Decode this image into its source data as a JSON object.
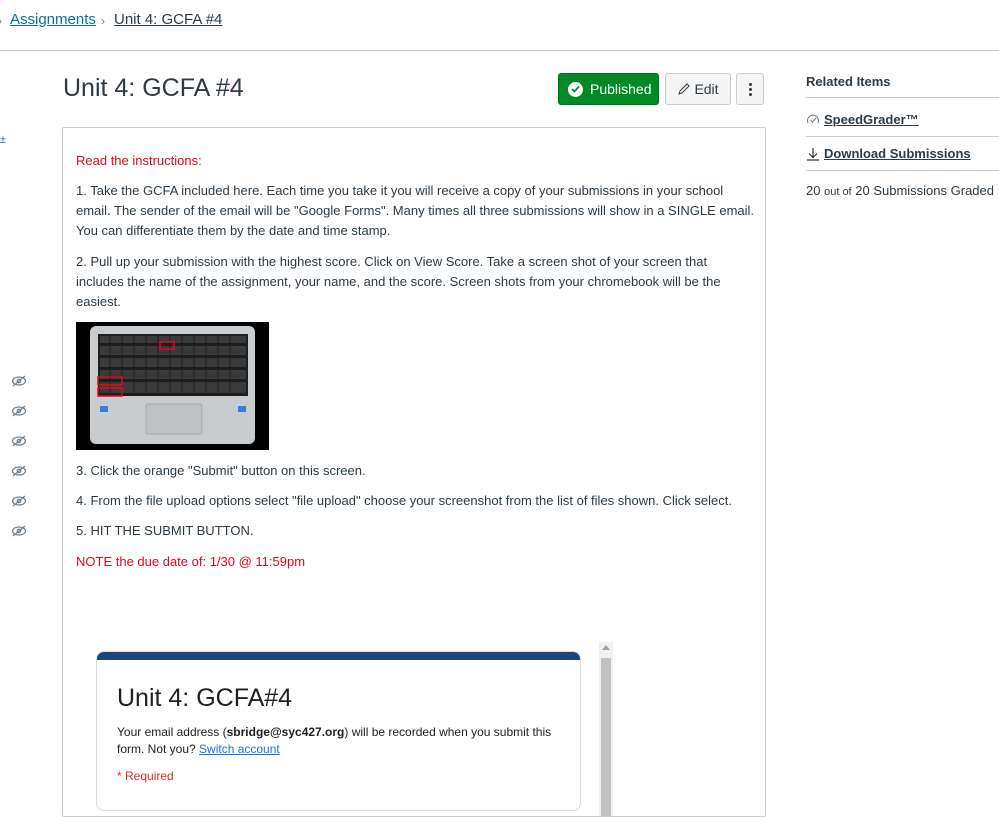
{
  "breadcrumb": {
    "items": [
      {
        "label": "Assignments"
      },
      {
        "label": "Unit 4: GCFA #4"
      }
    ]
  },
  "left_gutter": {
    "link_glyph": "±"
  },
  "header": {
    "title": "Unit 4: GCFA #4",
    "published_label": "Published",
    "edit_label": "Edit"
  },
  "description": {
    "heading": "Read the instructions:",
    "steps": [
      "1. Take the GCFA included here.  Each time you take it you will receive a copy of your submissions in your school email.  The sender of the email will be \"Google Forms\".  Many times all three submissions will show in a SINGLE email.  You can differentiate them by the date and time stamp.",
      "2. Pull up your submission with the highest score.  Click on View Score.  Take a screen shot of your screen that includes the name of the assignment, your name, and the score.  Screen shots from your chromebook will be the easiest.",
      "3.  Click the orange \"Submit\" button on this screen.",
      "4.  From the file upload options select \"file upload\" choose your screenshot from the list of files shown.  Click select.",
      "5.  HIT THE SUBMIT BUTTON."
    ],
    "note": "NOTE the due date of: 1/30 @ 11:59pm"
  },
  "embedded_form": {
    "title": "Unit 4: GCFA#4",
    "email_prefix": "Your email address (",
    "email": "sbridge@syc427.org",
    "email_suffix": ") will be recorded when you submit this form. Not you? ",
    "switch_account": "Switch account",
    "required": "* Required"
  },
  "sidebar": {
    "heading": "Related Items",
    "speedgrader_label": "SpeedGrader™",
    "download_label": "Download Submissions",
    "graded_count": "20",
    "graded_out_of": "out of",
    "graded_total": "20 Submissions Graded"
  },
  "colors": {
    "link": "#0770a3",
    "published_green": "#008a26",
    "instruction_red": "#e0061f",
    "form_header": "#1a4778"
  }
}
